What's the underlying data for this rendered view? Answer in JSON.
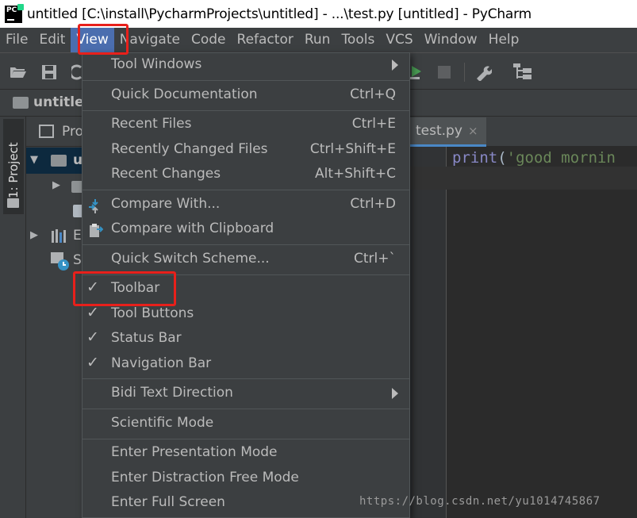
{
  "window": {
    "title": "untitled [C:\\install\\PycharmProjects\\untitled] - ...\\test.py [untitled] - PyCharm",
    "logo_text": "PC"
  },
  "menubar": {
    "items": [
      "File",
      "Edit",
      "View",
      "Navigate",
      "Code",
      "Refactor",
      "Run",
      "Tools",
      "VCS",
      "Window",
      "Help"
    ],
    "active": "View"
  },
  "navbar": {
    "label": "untitled"
  },
  "sidebar": {
    "project_tab": "1: Project"
  },
  "project_panel": {
    "title": "Pro",
    "tree": [
      {
        "label": "u"
      },
      {
        "label": "E"
      },
      {
        "label": "S"
      }
    ]
  },
  "editor": {
    "tab_label": "test.py",
    "tab_close": "×",
    "code": {
      "fn": "print",
      "open": "(",
      "string": "'good mornin"
    }
  },
  "view_menu": {
    "items": [
      {
        "label": "Tool Windows",
        "submenu": true
      },
      {
        "label": "Quick Documentation",
        "shortcut": "Ctrl+Q"
      },
      {
        "label": "Recent Files",
        "shortcut": "Ctrl+E"
      },
      {
        "label": "Recently Changed Files",
        "shortcut": "Ctrl+Shift+E"
      },
      {
        "label": "Recent Changes",
        "shortcut": "Alt+Shift+C"
      },
      {
        "label": "Compare With...",
        "shortcut": "Ctrl+D",
        "icon": "compare-icon"
      },
      {
        "label": "Compare with Clipboard",
        "icon": "clipboard-compare-icon"
      },
      {
        "label": "Quick Switch Scheme...",
        "shortcut": "Ctrl+`"
      },
      {
        "label": "Toolbar",
        "checked": true
      },
      {
        "label": "Tool Buttons",
        "checked": true
      },
      {
        "label": "Status Bar",
        "checked": true
      },
      {
        "label": "Navigation Bar",
        "checked": true
      },
      {
        "label": "Bidi Text Direction",
        "submenu": true
      },
      {
        "label": "Scientific Mode"
      },
      {
        "label": "Enter Presentation Mode"
      },
      {
        "label": "Enter Distraction Free Mode"
      },
      {
        "label": "Enter Full Screen"
      }
    ],
    "check_glyph": "✓"
  },
  "watermark": "https://blog.csdn.net/yu1014745867",
  "colors": {
    "menu_bg": "#3c3f41",
    "active_menu": "#4b6eaf",
    "highlight_box": "#e8201b",
    "editor_bg": "#2b2b2b"
  }
}
